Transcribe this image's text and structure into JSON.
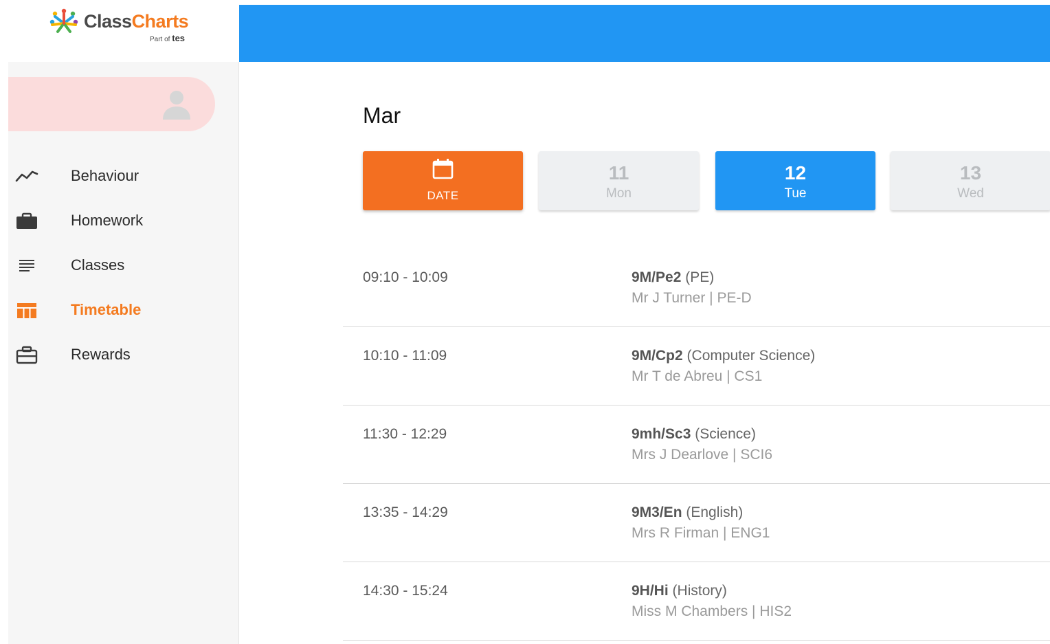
{
  "brand": {
    "name_part1": "Class",
    "name_part2": "Charts",
    "tagline_prefix": "Part of",
    "tagline_brand": "tes",
    "colors": {
      "orange": "#f47b20",
      "blue": "#2196f3",
      "grey_text": "#4a4a4a"
    }
  },
  "user": {
    "avatar_icon": "user-silhouette-icon"
  },
  "sidebar": {
    "items": [
      {
        "label": "Behaviour",
        "icon": "trend-line-icon",
        "active": false
      },
      {
        "label": "Homework",
        "icon": "briefcase-icon",
        "active": false
      },
      {
        "label": "Classes",
        "icon": "list-lines-icon",
        "active": false
      },
      {
        "label": "Timetable",
        "icon": "timetable-grid-icon",
        "active": true
      },
      {
        "label": "Rewards",
        "icon": "gift-box-icon",
        "active": false
      }
    ]
  },
  "timetable": {
    "month": "Mar",
    "date_picker_label": "DATE",
    "date_picker_icon": "calendar-icon",
    "days": [
      {
        "num": "11",
        "name": "Mon",
        "selected": false
      },
      {
        "num": "12",
        "name": "Tue",
        "selected": true
      },
      {
        "num": "13",
        "name": "Wed",
        "selected": false
      }
    ],
    "lessons": [
      {
        "time": "09:10 - 10:09",
        "class_code": "9M/Pe2",
        "subject": "(PE)",
        "teacher_room": "Mr J Turner | PE-D"
      },
      {
        "time": "10:10 - 11:09",
        "class_code": "9M/Cp2",
        "subject": "(Computer Science)",
        "teacher_room": "Mr T de Abreu | CS1"
      },
      {
        "time": "11:30 - 12:29",
        "class_code": "9mh/Sc3",
        "subject": "(Science)",
        "teacher_room": "Mrs J Dearlove | SCI6"
      },
      {
        "time": "13:35 - 14:29",
        "class_code": "9M3/En",
        "subject": "(English)",
        "teacher_room": "Mrs R Firman | ENG1"
      },
      {
        "time": "14:30 - 15:24",
        "class_code": "9H/Hi",
        "subject": "(History)",
        "teacher_room": "Miss M Chambers | HIS2"
      }
    ]
  }
}
